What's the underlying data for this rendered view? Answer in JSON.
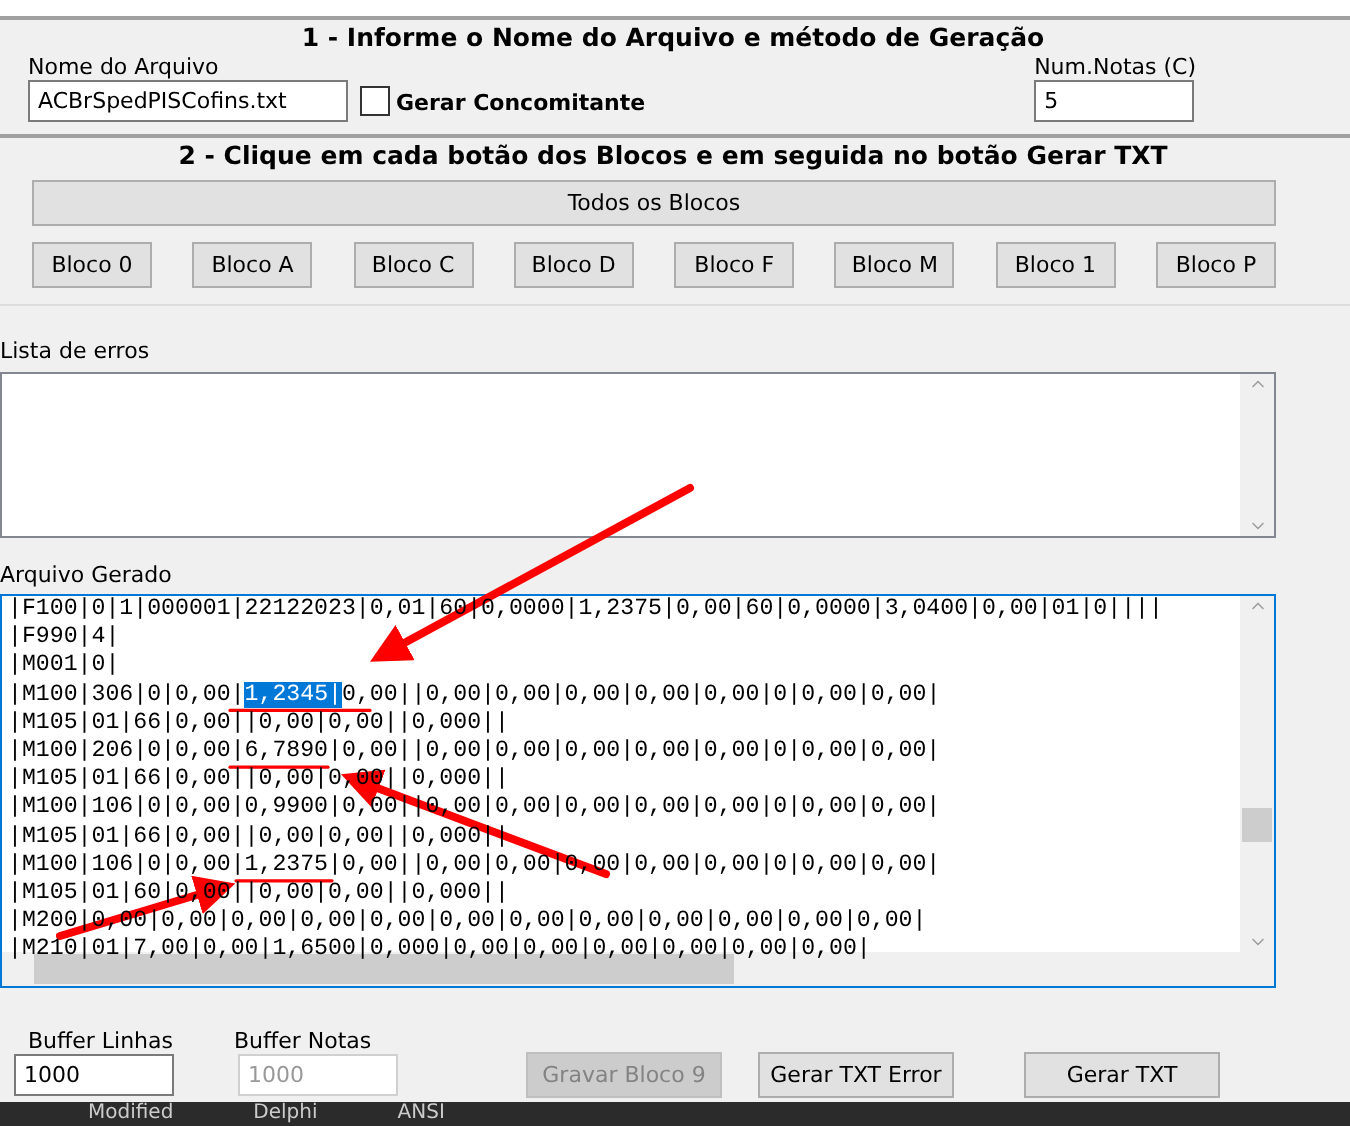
{
  "section_1": {
    "title": "1 - Informe o Nome do Arquivo e método de Geração",
    "file_name": {
      "label": "Nome do Arquivo",
      "value": "ACBrSpedPISCofins.txt"
    },
    "concurrent": {
      "label": "Gerar Concomitante",
      "checked": false
    },
    "num_notas": {
      "label": "Num.Notas (C)",
      "value": "5"
    }
  },
  "section_2": {
    "title": "2 - Clique em cada botão dos Blocos e em seguida no botão Gerar TXT",
    "all_button": "Todos os Blocos",
    "block_buttons": [
      "Bloco 0",
      "Bloco A",
      "Bloco C",
      "Bloco D",
      "Bloco F",
      "Bloco M",
      "Bloco 1",
      "Bloco P"
    ]
  },
  "error_list": {
    "label": "Lista de erros"
  },
  "generated_file": {
    "label": "Arquivo Gerado",
    "lines": [
      {
        "text": "|F100|0|1|000001|22122023|0,01|60|0,0000|1,2375|0,00|60|0,0000|3,0400|0,00|01|0||||"
      },
      {
        "text": "|F990|4|"
      },
      {
        "text": "|M001|0|"
      },
      {
        "text": "|M100|306|0|0,00|",
        "highlight": "1,2345|",
        "rest": "0,00||0,00|0,00|0,00|0,00|0,00|0|0,00|0,00|"
      },
      {
        "text": "|M105|01|66|0,00||0,00|0,00||0,000||"
      },
      {
        "text": "|M100|206|0|0,00|6,7890|0,00||0,00|0,00|0,00|0,00|0,00|0|0,00|0,00|"
      },
      {
        "text": "|M105|01|66|0,00||0,00|0,00||0,000||"
      },
      {
        "text": "|M100|106|0|0,00|0,9900|0,00||0,00|0,00|0,00|0,00|0,00|0|0,00|0,00|"
      },
      {
        "text": "|M105|01|66|0,00||0,00|0,00||0,000||"
      },
      {
        "text": "|M100|106|0|0,00|1,2375|0,00||0,00|0,00|0,00|0,00|0,00|0|0,00|0,00|"
      },
      {
        "text": "|M105|01|60|0,00||0,00|0,00||0,000||"
      },
      {
        "text": "|M200|0,00|0,00|0,00|0,00|0,00|0,00|0,00|0,00|0,00|0,00|0,00|0,00|"
      },
      {
        "text": "|M210|01|7,00|0,00|1,6500|0,000|0,00|0,00|0,00|0,00|0,00|0,00|"
      }
    ]
  },
  "buffer_linhas": {
    "label": "Buffer Linhas",
    "value": "1000",
    "disabled": false
  },
  "buffer_notas": {
    "label": "Buffer Notas",
    "value": "1000",
    "disabled": true
  },
  "buttons": [
    {
      "label": "Gravar Bloco 9",
      "disabled": true
    },
    {
      "label": "Gerar TXT Error",
      "disabled": false
    },
    {
      "label": "Gerar TXT",
      "disabled": false
    }
  ],
  "status_bar": [
    "Modified",
    "Delphi",
    "ANSI"
  ]
}
